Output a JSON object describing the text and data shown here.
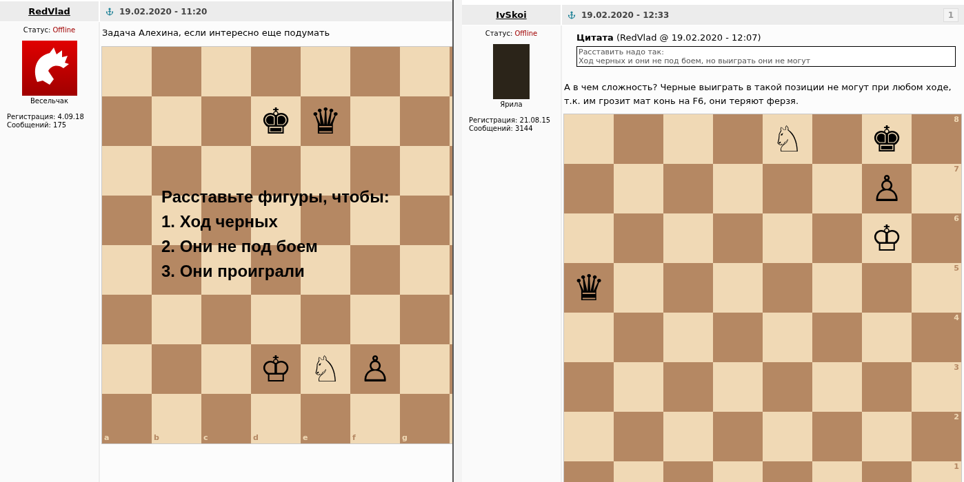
{
  "posts": [
    {
      "author": "RedVlad",
      "status_label": "Статус:",
      "status": "Offline",
      "avatar": {
        "kind": "logo",
        "caption": "Весельчак"
      },
      "registration": "Регистрация: 4.09.18",
      "messages": "Сообщений: 175",
      "date": "19.02.2020 - 11:20",
      "text": "Задача Алехина, если интересно еще подумать",
      "board": {
        "overlay_lines": [
          "Расставьте фигуры, чтобы:",
          "1. Ход черных",
          "2. Они не под боем",
          "3. Они проиграли"
        ],
        "rows": [
          [
            {
              "kind": "light"
            },
            {
              "kind": "dark"
            },
            {
              "kind": "light"
            },
            {
              "kind": "dark"
            },
            {
              "kind": "light"
            },
            {
              "kind": "dark"
            },
            {
              "kind": "light"
            },
            {
              "kind": "dark"
            }
          ],
          [
            {
              "kind": "dark"
            },
            {
              "kind": "light"
            },
            {
              "kind": "dark"
            },
            {
              "kind": "light",
              "piece": "♚"
            },
            {
              "kind": "dark",
              "piece": "♛"
            },
            {
              "kind": "light"
            },
            {
              "kind": "dark"
            },
            {
              "kind": "light"
            }
          ],
          [
            {
              "kind": "light"
            },
            {
              "kind": "dark"
            },
            {
              "kind": "light"
            },
            {
              "kind": "dark"
            },
            {
              "kind": "light"
            },
            {
              "kind": "dark"
            },
            {
              "kind": "light"
            },
            {
              "kind": "dark"
            }
          ],
          [
            {
              "kind": "dark"
            },
            {
              "kind": "light"
            },
            {
              "kind": "dark"
            },
            {
              "kind": "light"
            },
            {
              "kind": "dark"
            },
            {
              "kind": "light"
            },
            {
              "kind": "dark"
            },
            {
              "kind": "light"
            }
          ],
          [
            {
              "kind": "light"
            },
            {
              "kind": "dark"
            },
            {
              "kind": "light"
            },
            {
              "kind": "dark"
            },
            {
              "kind": "light"
            },
            {
              "kind": "dark"
            },
            {
              "kind": "light"
            },
            {
              "kind": "dark"
            }
          ],
          [
            {
              "kind": "dark"
            },
            {
              "kind": "light"
            },
            {
              "kind": "dark"
            },
            {
              "kind": "light"
            },
            {
              "kind": "dark"
            },
            {
              "kind": "light"
            },
            {
              "kind": "dark"
            },
            {
              "kind": "light"
            }
          ],
          [
            {
              "kind": "light"
            },
            {
              "kind": "dark"
            },
            {
              "kind": "light"
            },
            {
              "kind": "dark",
              "piece": "♔"
            },
            {
              "kind": "light",
              "piece": "♘"
            },
            {
              "kind": "dark",
              "piece": "♙"
            },
            {
              "kind": "light"
            },
            {
              "kind": "dark"
            }
          ],
          [
            {
              "kind": "dark",
              "file_label": "a"
            },
            {
              "kind": "light",
              "file_label": "b"
            },
            {
              "kind": "dark",
              "file_label": "c"
            },
            {
              "kind": "light",
              "file_label": "d"
            },
            {
              "kind": "dark",
              "file_label": "e"
            },
            {
              "kind": "light",
              "file_label": "f"
            },
            {
              "kind": "dark",
              "file_label": "g"
            },
            {
              "kind": "light"
            }
          ]
        ]
      }
    },
    {
      "author": "IvSkoi",
      "status_label": "Статус:",
      "status": "Offline",
      "avatar": {
        "kind": "photo",
        "caption": "Ярила"
      },
      "registration": "Регистрация: 21.08.15",
      "messages": "Сообщений: 3144",
      "date": "19.02.2020 - 12:33",
      "number": "1",
      "quote": {
        "title": "Цитата",
        "source": "(RedVlad @ 19.02.2020 - 12:07)",
        "lines": [
          "Расставить надо так:",
          "Ход черных и они не под боем, но выиграть они не могут"
        ]
      },
      "text": "А в чем сложность? Черные выиграть в такой позиции не могут при любом ходе, т.к. им грозит мат конь на F6, они теряют ферзя.",
      "board": {
        "rows": [
          [
            {
              "kind": "light"
            },
            {
              "kind": "dark"
            },
            {
              "kind": "light"
            },
            {
              "kind": "dark"
            },
            {
              "kind": "light",
              "piece": "♘"
            },
            {
              "kind": "dark"
            },
            {
              "kind": "light",
              "piece": "♚"
            },
            {
              "kind": "dark",
              "rank_label": "8"
            }
          ],
          [
            {
              "kind": "dark"
            },
            {
              "kind": "light"
            },
            {
              "kind": "dark"
            },
            {
              "kind": "light"
            },
            {
              "kind": "dark"
            },
            {
              "kind": "light"
            },
            {
              "kind": "dark",
              "piece": "♙"
            },
            {
              "kind": "light",
              "rank_label": "7"
            }
          ],
          [
            {
              "kind": "light"
            },
            {
              "kind": "dark"
            },
            {
              "kind": "light"
            },
            {
              "kind": "dark"
            },
            {
              "kind": "light"
            },
            {
              "kind": "dark"
            },
            {
              "kind": "light",
              "piece": "♔"
            },
            {
              "kind": "dark",
              "rank_label": "6"
            }
          ],
          [
            {
              "kind": "dark",
              "piece": "♛"
            },
            {
              "kind": "light"
            },
            {
              "kind": "dark"
            },
            {
              "kind": "light"
            },
            {
              "kind": "dark"
            },
            {
              "kind": "light"
            },
            {
              "kind": "dark"
            },
            {
              "kind": "light",
              "rank_label": "5"
            }
          ],
          [
            {
              "kind": "light"
            },
            {
              "kind": "dark"
            },
            {
              "kind": "light"
            },
            {
              "kind": "dark"
            },
            {
              "kind": "light"
            },
            {
              "kind": "dark"
            },
            {
              "kind": "light"
            },
            {
              "kind": "dark",
              "rank_label": "4"
            }
          ],
          [
            {
              "kind": "dark"
            },
            {
              "kind": "light"
            },
            {
              "kind": "dark"
            },
            {
              "kind": "light"
            },
            {
              "kind": "dark"
            },
            {
              "kind": "light"
            },
            {
              "kind": "dark"
            },
            {
              "kind": "light",
              "rank_label": "3"
            }
          ],
          [
            {
              "kind": "light"
            },
            {
              "kind": "dark"
            },
            {
              "kind": "light"
            },
            {
              "kind": "dark"
            },
            {
              "kind": "light"
            },
            {
              "kind": "dark"
            },
            {
              "kind": "light"
            },
            {
              "kind": "dark",
              "rank_label": "2"
            }
          ],
          [
            {
              "kind": "dark"
            },
            {
              "kind": "light"
            },
            {
              "kind": "dark"
            },
            {
              "kind": "light"
            },
            {
              "kind": "dark"
            },
            {
              "kind": "light"
            },
            {
              "kind": "dark"
            },
            {
              "kind": "light",
              "rank_label": "1"
            }
          ]
        ]
      }
    }
  ]
}
